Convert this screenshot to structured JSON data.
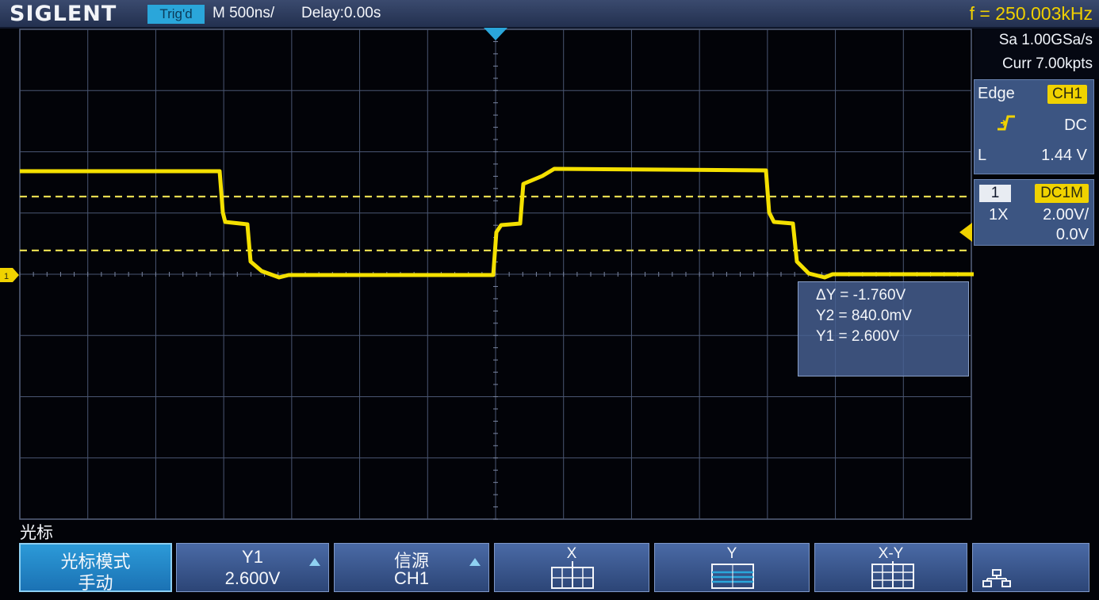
{
  "header": {
    "brand": "SIGLENT",
    "trigger_status": "Trig'd",
    "timebase": "M 500ns/",
    "delay": "Delay:0.00s",
    "frequency": "f = 250.003kHz"
  },
  "acquisition": {
    "sample_rate": "Sa 1.00GSa/s",
    "memory_depth": "Curr 7.00kpts"
  },
  "trigger_panel": {
    "type": "Edge",
    "source": "CH1",
    "slope_icon": "rising-edge-icon",
    "coupling": "DC",
    "level_label": "L",
    "level_value": "1.44 V"
  },
  "channel_panel": {
    "channel": "1",
    "coupling_impedance": "DC1M",
    "probe": "1X",
    "scale": "2.00V/",
    "offset": "0.0V"
  },
  "cursor_measurements": {
    "delta_y": "ΔY = -1.760V",
    "y2": "Y2 = 840.0mV",
    "y1": "Y1 = 2.600V"
  },
  "menu": {
    "title": "光标",
    "softkeys": [
      {
        "label": "光标模式",
        "value": "手动",
        "active": true
      },
      {
        "label": "Y1",
        "value": "2.600V",
        "adjustable": true
      },
      {
        "label": "信源",
        "value": "CH1",
        "adjustable": true
      },
      {
        "label": "X",
        "icon": "x-cursor-icon"
      },
      {
        "label": "Y",
        "icon": "y-cursor-icon"
      },
      {
        "label": "X-Y",
        "icon": "xy-cursor-icon"
      },
      {
        "icon": "network-icon"
      }
    ]
  },
  "colors": {
    "trace": "#f4e000",
    "grid": "#4a5672",
    "panel": "#3c5582",
    "header": "#2a3a5e",
    "active_softkey": "#2c9ad8"
  },
  "display": {
    "horizontal_divisions": 14,
    "vertical_divisions": 8,
    "channel1_ground_marker": "1"
  }
}
